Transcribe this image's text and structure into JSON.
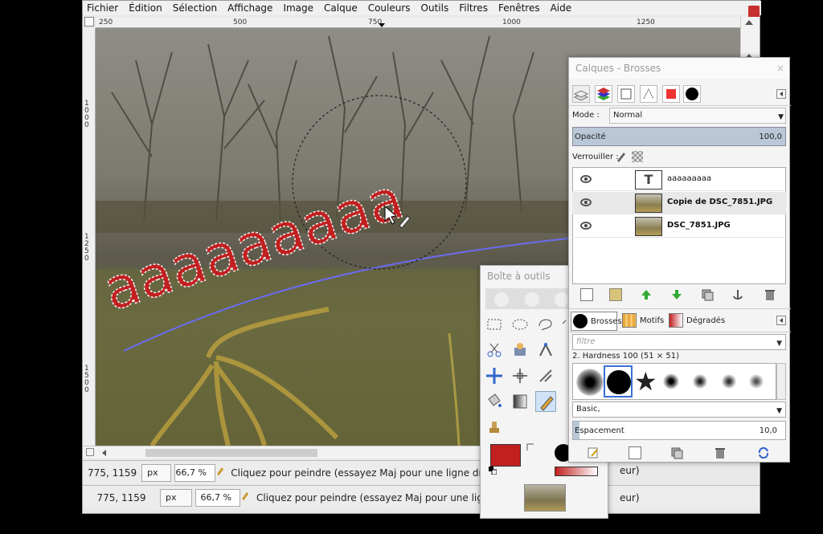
{
  "menu": [
    "Fichier",
    "Édition",
    "Sélection",
    "Affichage",
    "Image",
    "Calque",
    "Couleurs",
    "Outils",
    "Filtres",
    "Fenêtres",
    "Aide"
  ],
  "ruler_h": [
    "250",
    "500",
    "750",
    "1000",
    "1250"
  ],
  "ruler_v": [
    "1000",
    "1250",
    "1500"
  ],
  "canvas_text": "aaaaaaaaa",
  "status": {
    "coords": "775, 1159",
    "unit": "px",
    "zoom": "66,7 %",
    "message": "Cliquez pour peindre (essayez Maj pour une ligne droite",
    "message_tail": "eur)"
  },
  "calques": {
    "title": "Calques - Brosses",
    "mode_label": "Mode :",
    "mode_value": "Normal",
    "opacity_label": "Opacité",
    "opacity_value": "100,0",
    "lock_label": "Verrouiller :",
    "layers": [
      {
        "name": "aaaaaaaaa"
      },
      {
        "name": "Copie de DSC_7851.JPG"
      },
      {
        "name": "DSC_7851.JPG"
      }
    ],
    "brush_tabs": [
      "Brosses",
      "Motifs",
      "Dégradés"
    ],
    "filter_placeholder": "filtre",
    "brush_name": "2. Hardness 100 (51 × 51)",
    "brush_set": "Basic,",
    "spacing_label": "Espacement",
    "spacing_value": "10,0"
  },
  "toolbox": {
    "title": "Boîte à outils"
  },
  "colors": {
    "foreground": "#c21f1f",
    "background": "#ffffff",
    "accent_path": "#6b6bf0"
  }
}
